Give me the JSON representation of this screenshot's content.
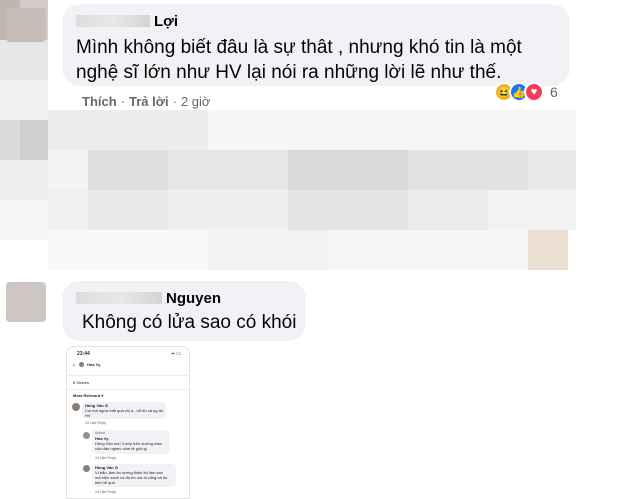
{
  "comment1": {
    "name_suffix": "Lợi",
    "text_line1": "Mình không biết đâu là sự thât , nhưng khó tin là một",
    "text_line2": "nghệ sĩ lớn như HV lại nói ra những lời lẽ như thế.",
    "like_label": "Thích",
    "separator": "·",
    "reply_label": "Trả lời",
    "time": "2 giờ",
    "reaction_icons": [
      "haha-icon",
      "like-icon",
      "love-icon"
    ],
    "reaction_count": "6"
  },
  "comment2": {
    "name_suffix": "Nguyen",
    "text": "Không có lửa sao có khói"
  },
  "phone": {
    "time": "23:44",
    "header_name": "Hòa Vy",
    "shares_label": "8 Shares",
    "sort_label": "Most Relevant ▾",
    "c1_name": "Hồng Vân ⊙",
    "c1_text1": "Coi mà ngứa mắt quá chị ạ...nổ đồ cả ng đó",
    "c1_text2": "HV",
    "c1_actions": "2d   Like   Reply",
    "r1_author": "Author",
    "r1_name": "Hòa Vy",
    "r1_text1": "Hông Vân mẹ! Cướp trên xướng màu",
    "r1_text2": "của dân nghèo chơi tệ giời gì",
    "r1_actions": "2d   Like   Reply",
    "c2_name": "Hồng Vân ⊙",
    "c2_text1": "Vì bẩn, làm ăn lương thiện thì làm sao",
    "c2_text2": "mà hiện xanh có đồ trò mà ai cũng cả bọ",
    "c2_text3": "tinh hể quá",
    "c2_actions": "2d   Like   Reply"
  },
  "colors": {
    "bubble_bg": "#f0f2f5",
    "secondary_text": "#65676b",
    "haha": "#f7b125",
    "like": "#1877f2",
    "love": "#f33e58"
  }
}
